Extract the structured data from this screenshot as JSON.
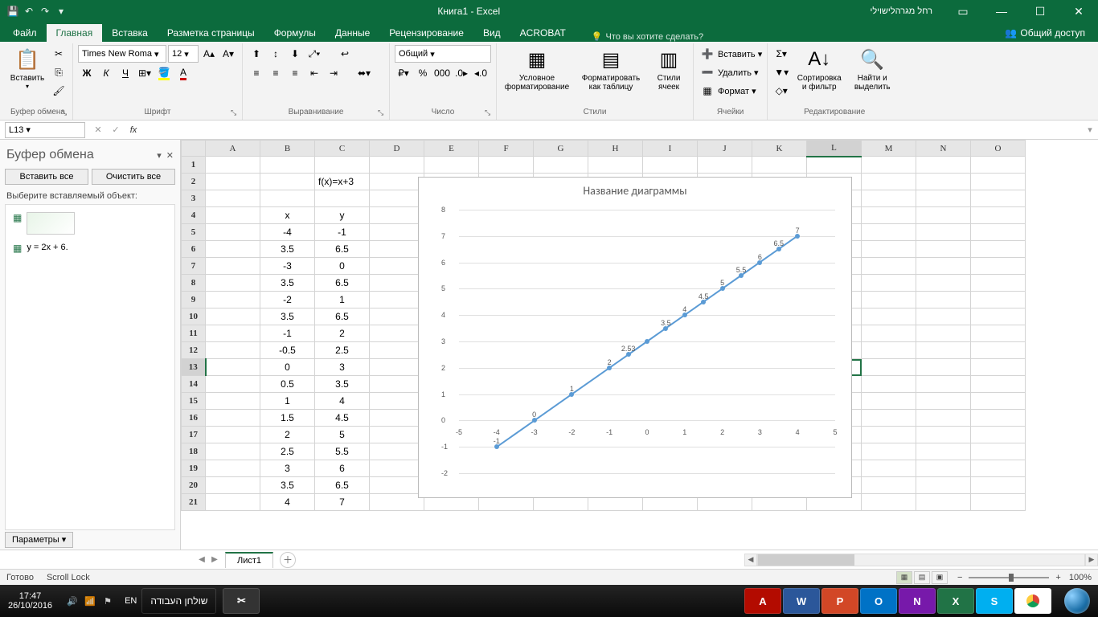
{
  "titlebar": {
    "title": "Книга1 - Excel",
    "user": "רחל מגרהלישוילי"
  },
  "tabs": {
    "file": "Файл",
    "home": "Главная",
    "insert": "Вставка",
    "layout": "Разметка страницы",
    "formulas": "Формулы",
    "data": "Данные",
    "review": "Рецензирование",
    "view": "Вид",
    "acrobat": "ACROBAT",
    "tellme": "Что вы хотите сделать?",
    "share": "Общий доступ"
  },
  "ribbon": {
    "paste": "Вставить",
    "clipboard_group": "Буфер обмена",
    "font_name": "Times New Roma",
    "font_size": "12",
    "font_group": "Шрифт",
    "align_group": "Выравнивание",
    "number_format": "Общий",
    "number_group": "Число",
    "cond_fmt": "Условное форматирование",
    "fmt_table": "Форматировать как таблицу",
    "cell_styles": "Стили ячеек",
    "styles_group": "Стили",
    "insert_cells": "Вставить",
    "delete_cells": "Удалить",
    "format_cells": "Формат",
    "cells_group": "Ячейки",
    "sort_filter": "Сортировка и фильтр",
    "find_select": "Найти и выделить",
    "edit_group": "Редактирование"
  },
  "namebox": "L13",
  "clipboard_pane": {
    "title": "Буфер обмена",
    "paste_all": "Вставить все",
    "clear_all": "Очистить все",
    "hint": "Выберите вставляемый объект:",
    "item1": "",
    "item2": "y = 2x + 6.",
    "params": "Параметры"
  },
  "columns": [
    "A",
    "B",
    "C",
    "D",
    "E",
    "F",
    "G",
    "H",
    "I",
    "J",
    "K",
    "L",
    "M",
    "N",
    "O"
  ],
  "rows": [
    {
      "n": 1,
      "b": "",
      "c": ""
    },
    {
      "n": 2,
      "b": "",
      "c": "f(x)=x+3"
    },
    {
      "n": 3,
      "b": "",
      "c": ""
    },
    {
      "n": 4,
      "b": "x",
      "c": "y"
    },
    {
      "n": 5,
      "b": "-4",
      "c": "-1"
    },
    {
      "n": 6,
      "b": "3.5",
      "c": "6.5"
    },
    {
      "n": 7,
      "b": "-3",
      "c": "0"
    },
    {
      "n": 8,
      "b": "3.5",
      "c": "6.5"
    },
    {
      "n": 9,
      "b": "-2",
      "c": "1"
    },
    {
      "n": 10,
      "b": "3.5",
      "c": "6.5"
    },
    {
      "n": 11,
      "b": "-1",
      "c": "2"
    },
    {
      "n": 12,
      "b": "-0.5",
      "c": "2.5"
    },
    {
      "n": 13,
      "b": "0",
      "c": "3"
    },
    {
      "n": 14,
      "b": "0.5",
      "c": "3.5"
    },
    {
      "n": 15,
      "b": "1",
      "c": "4"
    },
    {
      "n": 16,
      "b": "1.5",
      "c": "4.5"
    },
    {
      "n": 17,
      "b": "2",
      "c": "5"
    },
    {
      "n": 18,
      "b": "2.5",
      "c": "5.5"
    },
    {
      "n": 19,
      "b": "3",
      "c": "6"
    },
    {
      "n": 20,
      "b": "3.5",
      "c": "6.5"
    },
    {
      "n": 21,
      "b": "4",
      "c": "7"
    }
  ],
  "chart_data": {
    "type": "line",
    "title": "Название диаграммы",
    "xlabel": "",
    "ylabel": "",
    "xlim": [
      -5,
      5
    ],
    "ylim": [
      -2,
      8
    ],
    "xticks": [
      -5,
      -4,
      -3,
      -2,
      -1,
      0,
      1,
      2,
      3,
      4,
      5
    ],
    "yticks": [
      -2,
      -1,
      0,
      1,
      2,
      3,
      4,
      5,
      6,
      7,
      8
    ],
    "x": [
      -4,
      -3,
      -2,
      -1,
      -0.5,
      0,
      0.5,
      1,
      1.5,
      2,
      2.5,
      3,
      3.5,
      4
    ],
    "y": [
      -1,
      0,
      1,
      2,
      2.5,
      3,
      3.5,
      4,
      4.5,
      5,
      5.5,
      6,
      6.5,
      7
    ],
    "data_labels": [
      "-1",
      "0",
      "1",
      "2",
      "2.53",
      "",
      "3.5",
      "4",
      "4.5",
      "5",
      "5.5",
      "6",
      "6.5",
      "7"
    ]
  },
  "sheet_tab": "Лист1",
  "status": {
    "ready": "Готово",
    "scroll_lock": "Scroll Lock",
    "zoom": "100%"
  },
  "taskbar": {
    "time": "17:47",
    "date": "26/10/2016",
    "lang": "EN",
    "desktop": "שולחן העבודה"
  }
}
